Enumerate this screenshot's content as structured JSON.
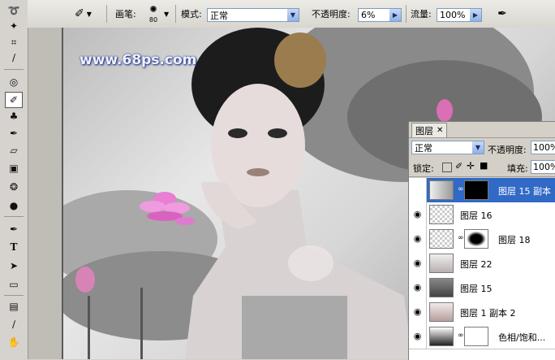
{
  "options_bar": {
    "brush_label": "画笔:",
    "brush_size": "80",
    "mode_label": "模式:",
    "mode_value": "正常",
    "opacity_label": "不透明度:",
    "opacity_value": "6%",
    "flow_label": "流量:",
    "flow_value": "100%"
  },
  "canvas": {
    "watermark": "www.68ps.com"
  },
  "layers_panel": {
    "tab_label": "图层",
    "blend_mode": "正常",
    "opacity_label": "不透明度:",
    "opacity_value": "100%",
    "lock_label": "锁定:",
    "fill_label": "填充:",
    "fill_value": "100%",
    "layers": [
      {
        "name": "图层 15 副本",
        "selected": true
      },
      {
        "name": "图层 16",
        "selected": false
      },
      {
        "name": "图层 18",
        "selected": false
      },
      {
        "name": "图层 22",
        "selected": false
      },
      {
        "name": "图层 15",
        "selected": false
      },
      {
        "name": "图层 1 副本 2",
        "selected": false
      },
      {
        "name": "色相/饱和...",
        "selected": false
      }
    ]
  },
  "colors": {
    "selection": "#3169c6",
    "panel": "#d4d0c8",
    "watermark_outline": "#1a2a80"
  }
}
